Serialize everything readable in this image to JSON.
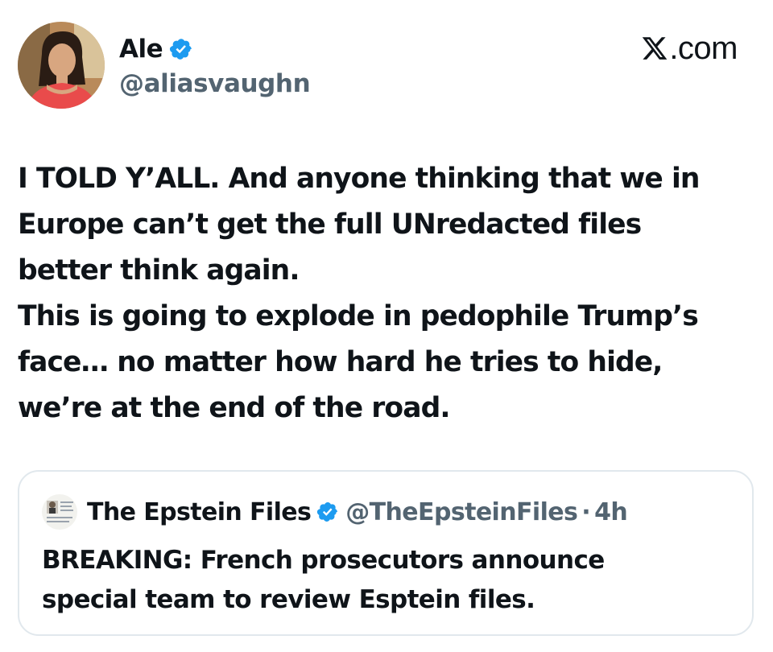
{
  "brand": {
    "logo_letter": "X",
    "logo_text": ".com",
    "verified_color": "#1d9bf0"
  },
  "author": {
    "name": "Ale",
    "handle": "@aliasvaughn",
    "verified": true,
    "avatar_icon": "profile-photo"
  },
  "tweet": {
    "text": "I TOLD Y’ALL. And anyone thinking that we in\nEurope can’t get the full UNredacted files\nbetter think again.\nThis is going to explode in pedophile Trump’s\nface… no matter how hard he tries to hide,\nwe’re at the end of the road."
  },
  "quote": {
    "name": "The Epstein Files",
    "handle": "@TheEpsteinFiles",
    "separator": "·",
    "time": "4h",
    "verified": true,
    "avatar_icon": "document-photo",
    "text": "BREAKING: French prosecutors announce\nspecial team to review Esptein files."
  }
}
